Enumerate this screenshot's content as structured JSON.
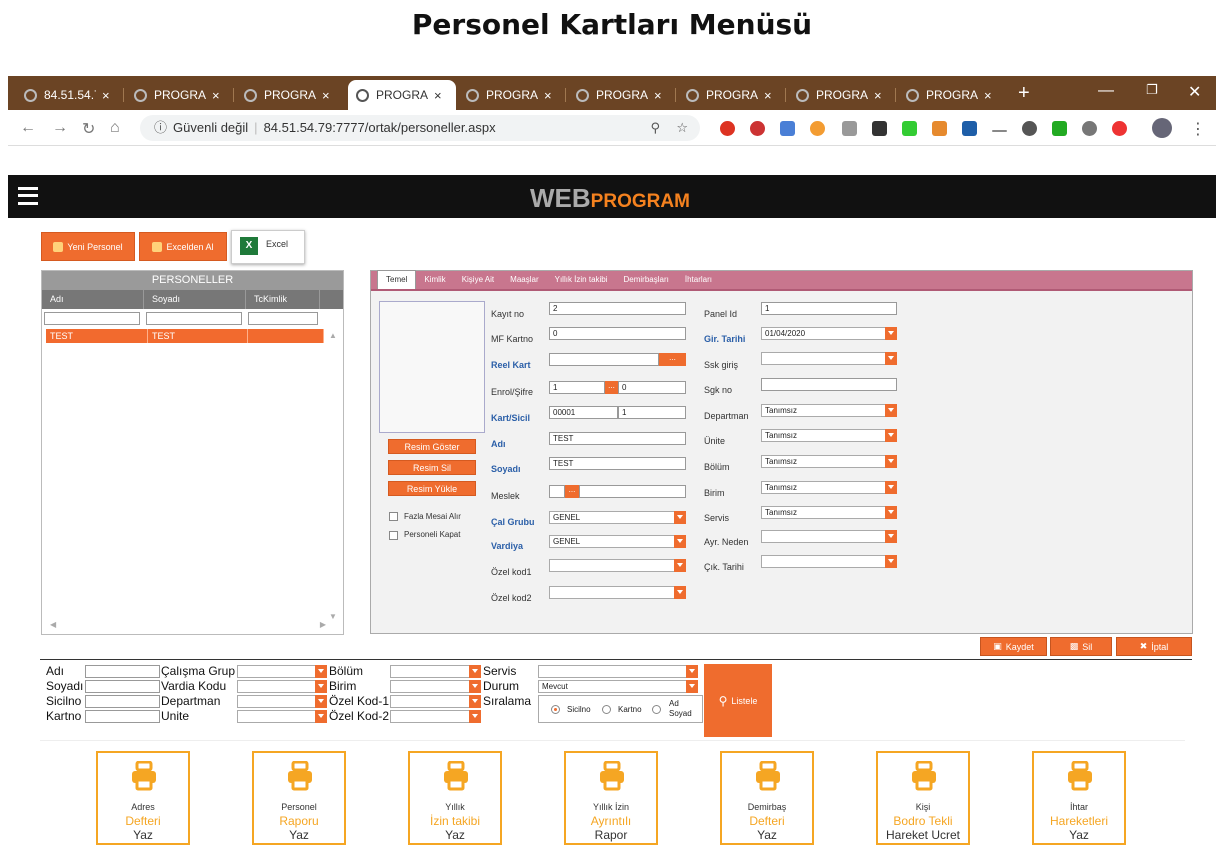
{
  "page_title": "Personel Kartları Menüsü",
  "browser": {
    "tabs": [
      {
        "label": "84.51.54.7"
      },
      {
        "label": "PROGRAM"
      },
      {
        "label": "PROGRAM"
      },
      {
        "label": "PROGRAM"
      },
      {
        "label": "PROGRAM"
      },
      {
        "label": "PROGRAM"
      },
      {
        "label": "PROGRAM"
      },
      {
        "label": "PROGRAM"
      },
      {
        "label": "PROGRAM"
      }
    ],
    "close_glyph": "×",
    "new_tab_glyph": "+",
    "security_text": "Güvenli değil",
    "url": "84.51.54.79:7777/ortak/personeller.aspx"
  },
  "app": {
    "brand_web": "WEB",
    "brand_program": "PROGRAM",
    "toolbar": {
      "new_label": "Yeni Personel",
      "import_label": "Excelden Al",
      "excel_label": "Excel"
    }
  },
  "personnel_list": {
    "title": "PERSONELLER",
    "columns": [
      "Adı",
      "Soyadı",
      "TcKimlik"
    ],
    "rows": [
      {
        "adi": "TEST",
        "soyadi": "TEST",
        "tckimlik": ""
      }
    ]
  },
  "form": {
    "tabs": [
      "Temel",
      "Kimlik",
      "Kişiye Ait",
      "Maaşlar",
      "Yıllık İzin takibi",
      "Demirbaşları",
      "İhtarları"
    ],
    "photo_buttons": {
      "show": "Resim Göster",
      "delete": "Resim Sil",
      "upload": "Resim Yükle"
    },
    "checkboxes": {
      "overtime": "Fazla Mesai Alır",
      "close": "Personeli Kapat"
    },
    "labels": {
      "kayit_no": "Kayıt no",
      "mf_kartno": "MF Kartno",
      "reel_kart": "Reel Kart",
      "enrol_sifre": "Enrol/Şifre",
      "kart_sicil": "Kart/Sicil",
      "adi": "Adı",
      "soyadi": "Soyadı",
      "meslek": "Meslek",
      "cal_grubu": "Çal Grubu",
      "vardiya": "Vardiya",
      "ozel_kod1": "Özel kod1",
      "ozel_kod2": "Özel kod2",
      "panel_id": "Panel Id",
      "gir_tarihi": "Gir. Tarihi",
      "ssk_giris": "Ssk giriş",
      "sgk_no": "Sgk no",
      "departman": "Departman",
      "unite": "Ünite",
      "bolum": "Bölüm",
      "birim": "Birim",
      "servis": "Servis",
      "ayr_neden": "Ayr. Neden",
      "cik_tarihi": "Çık. Tarihi"
    },
    "values": {
      "kayit_no": "2",
      "mf_kartno": "0",
      "reel_kart": "",
      "enrol": "1",
      "sifre": "0",
      "kart": "00001",
      "sicil": "1",
      "adi": "TEST",
      "soyadi": "TEST",
      "meslek": "",
      "cal_grubu": "GENEL",
      "vardiya": "GENEL",
      "ozel_kod1": "",
      "ozel_kod2": "",
      "panel_id": "1",
      "gir_tarihi": "01/04/2020",
      "ssk_giris": "",
      "sgk_no": "",
      "departman": "Tanımsız",
      "unite": "Tanımsız",
      "bolum": "Tanımsız",
      "birim": "Tanımsız",
      "servis": "Tanımsız",
      "ayr_neden": "",
      "cik_tarihi": ""
    },
    "dots": "...",
    "actions": {
      "save": "Kaydet",
      "delete": "Sil",
      "cancel": "İptal"
    }
  },
  "filters": {
    "labels": {
      "adi": "Adı",
      "soyadi": "Soyadı",
      "sicilno": "Sicilno",
      "kartno": "Kartno",
      "calisma_grup": "Çalışma Grup",
      "vardia_kodu": "Vardia Kodu",
      "departman": "Departman",
      "unite": "Unite",
      "bolum": "Bölüm",
      "birim": "Birim",
      "ozel_kod1": "Özel Kod-1",
      "ozel_kod2": "Özel Kod-2",
      "servis": "Servis",
      "durum": "Durum",
      "siralama": "Sıralama"
    },
    "durum_value": "Mevcut",
    "sort_options": {
      "sicilno": "Sicilno",
      "kartno": "Kartno",
      "ad": "Ad",
      "soyad": "Soyad"
    },
    "list_button": "Listele"
  },
  "reports": [
    {
      "l1": "Adres",
      "l2": "Defteri",
      "l3": "Yaz"
    },
    {
      "l1": "Personel",
      "l2": "Raporu",
      "l3": "Yaz"
    },
    {
      "l1": "Yıllık",
      "l2": "İzin takibi",
      "l3": "Yaz"
    },
    {
      "l1": "Yıllık İzin",
      "l2": "Ayrıntılı",
      "l3": "Rapor"
    },
    {
      "l1": "Demirbaş",
      "l2": "Defteri",
      "l3": "Yaz"
    },
    {
      "l1": "Kişi",
      "l2": "Bodro Tekli",
      "l3": "Hareket Ucret"
    },
    {
      "l1": "İhtar",
      "l2": "Hareketleri",
      "l3": "Yaz"
    }
  ],
  "colors": {
    "accent": "#ef6c2e",
    "tabbar": "#6b4424",
    "report_border": "#f5a623",
    "form_tabs": "#c8768e"
  }
}
